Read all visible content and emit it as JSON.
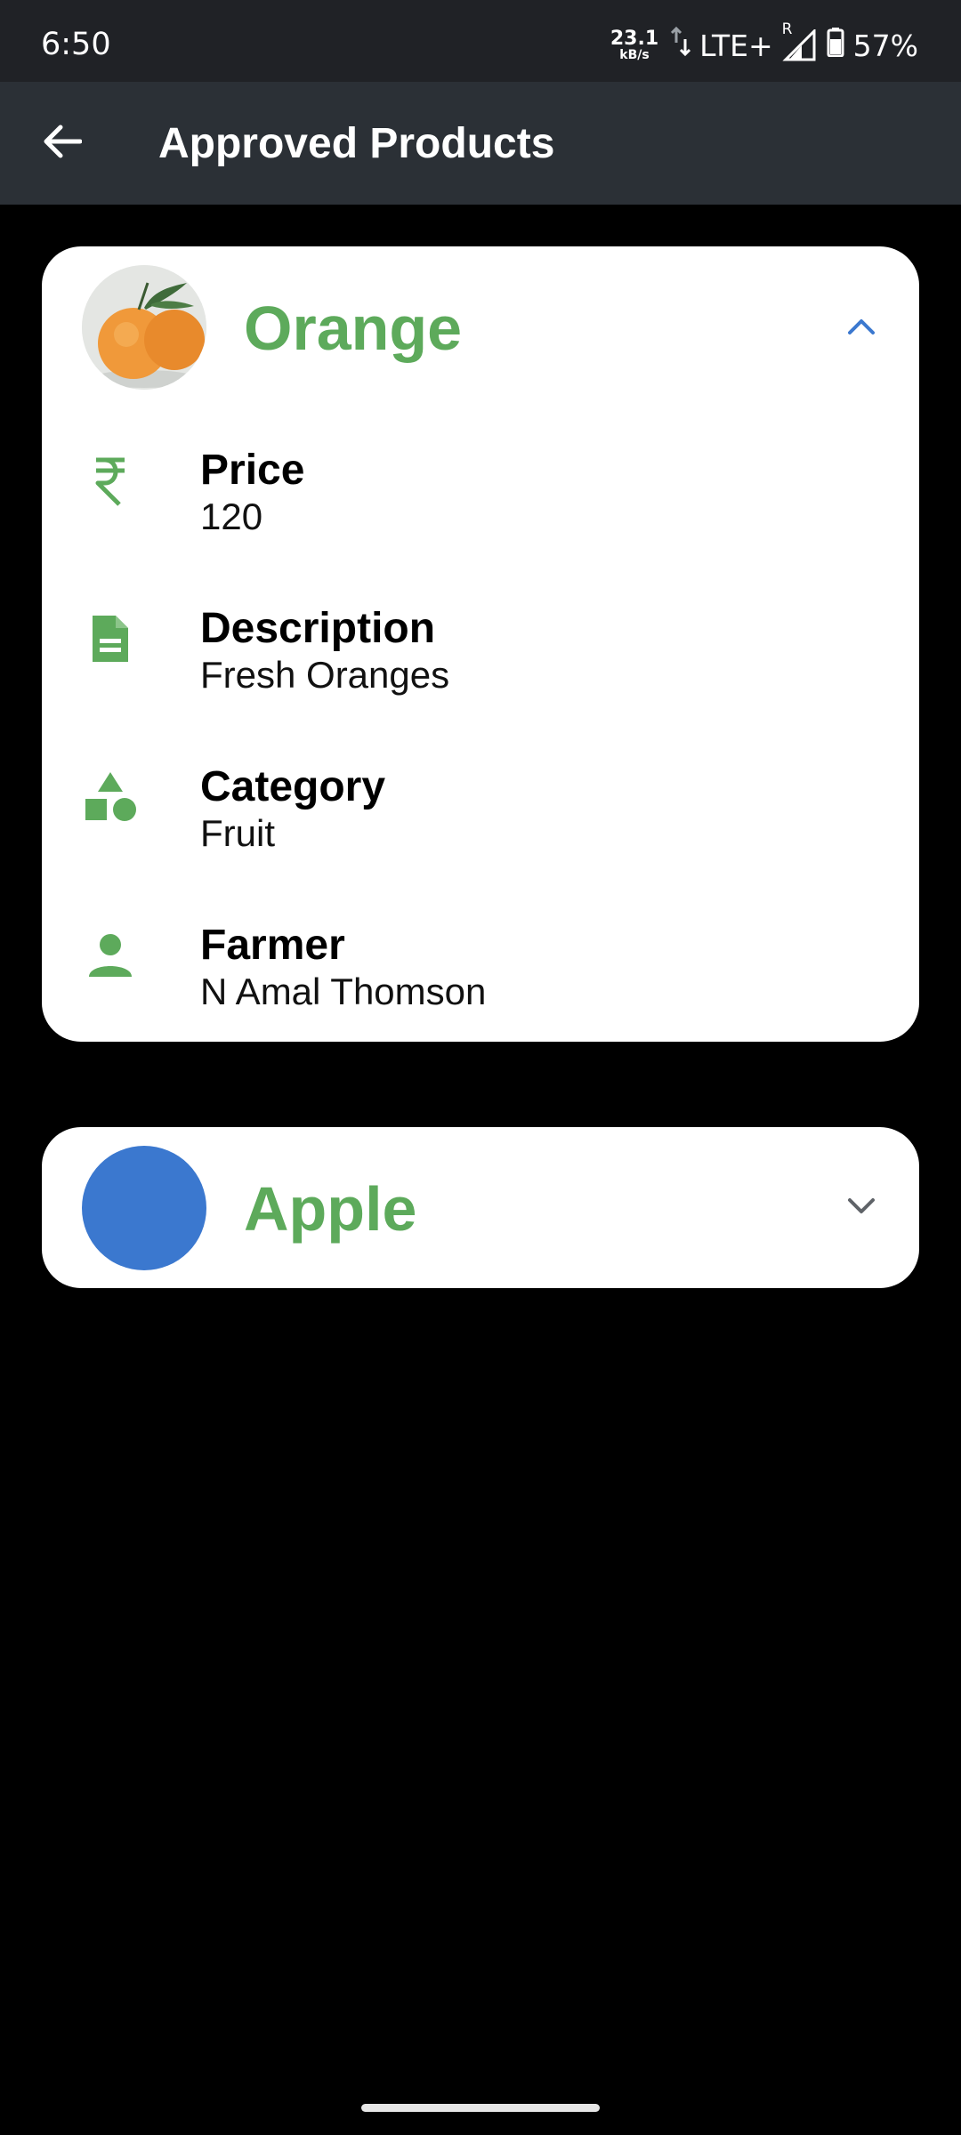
{
  "status_bar": {
    "time": "6:50",
    "net_speed_value": "23.1",
    "net_speed_unit": "kB/s",
    "network": "LTE+",
    "roaming": "R",
    "battery": "57%"
  },
  "app_bar": {
    "title": "Approved Products"
  },
  "products": [
    {
      "name": "Orange",
      "expanded": true,
      "details": [
        {
          "icon": "rupee-icon",
          "label": "Price",
          "value": "120"
        },
        {
          "icon": "description-icon",
          "label": "Description",
          "value": "Fresh Oranges"
        },
        {
          "icon": "category-icon",
          "label": "Category",
          "value": "Fruit"
        },
        {
          "icon": "person-icon",
          "label": "Farmer",
          "value": "N Amal Thomson"
        }
      ]
    },
    {
      "name": "Apple",
      "expanded": false
    }
  ],
  "colors": {
    "accent_green": "#5daa5b",
    "chevron_blue": "#3b78cf",
    "apple_avatar": "#3b78cf"
  }
}
